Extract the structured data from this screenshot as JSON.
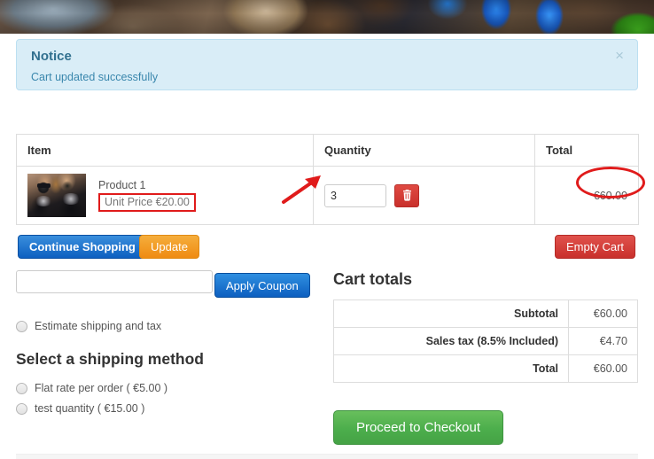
{
  "banner": {
    "alt": "nature-photo-banner"
  },
  "notice": {
    "title": "Notice",
    "message": "Cart updated successfully",
    "close_label": "×"
  },
  "cart_table": {
    "headers": [
      "Item",
      "Quantity",
      "Total"
    ],
    "rows": [
      {
        "item_name": "Product 1",
        "unit_price": "Unit Price €20.00",
        "quantity": "3",
        "quantity_placeholder": "",
        "total": "€60.00",
        "delete_title": "Remove item"
      }
    ]
  },
  "actions": {
    "continue_shopping": "Continue Shopping",
    "update": "Update",
    "empty_cart": "Empty Cart",
    "apply_coupon": "Apply Coupon",
    "coupon_value": "",
    "coupon_placeholder": ""
  },
  "shipping": {
    "estimate_label": "Estimate shipping and tax",
    "heading": "Select a shipping method",
    "methods": [
      {
        "label": "Flat rate per order ( €5.00 )",
        "selected": false
      },
      {
        "label": "test quantity ( €15.00 )",
        "selected": false
      }
    ]
  },
  "cart_totals": {
    "heading": "Cart totals",
    "rows": [
      {
        "label": "Subtotal",
        "value": "€60.00"
      },
      {
        "label": "Sales tax (8.5% Included)",
        "value": "€4.70"
      },
      {
        "label": "Total",
        "value": "€60.00"
      }
    ],
    "checkout_label": "Proceed to Checkout"
  },
  "annotations": {
    "ellipse_target": "€60.00",
    "arrow_target": "quantity input"
  },
  "colors": {
    "notice_bg": "#d9edf7",
    "notice_text": "#31708f",
    "primary_blue": "#0d5fc0",
    "warning_orange": "#ef8b12",
    "danger_red": "#c9302c",
    "success_green": "#4cae4c",
    "annotation_red": "#e01b1b"
  }
}
